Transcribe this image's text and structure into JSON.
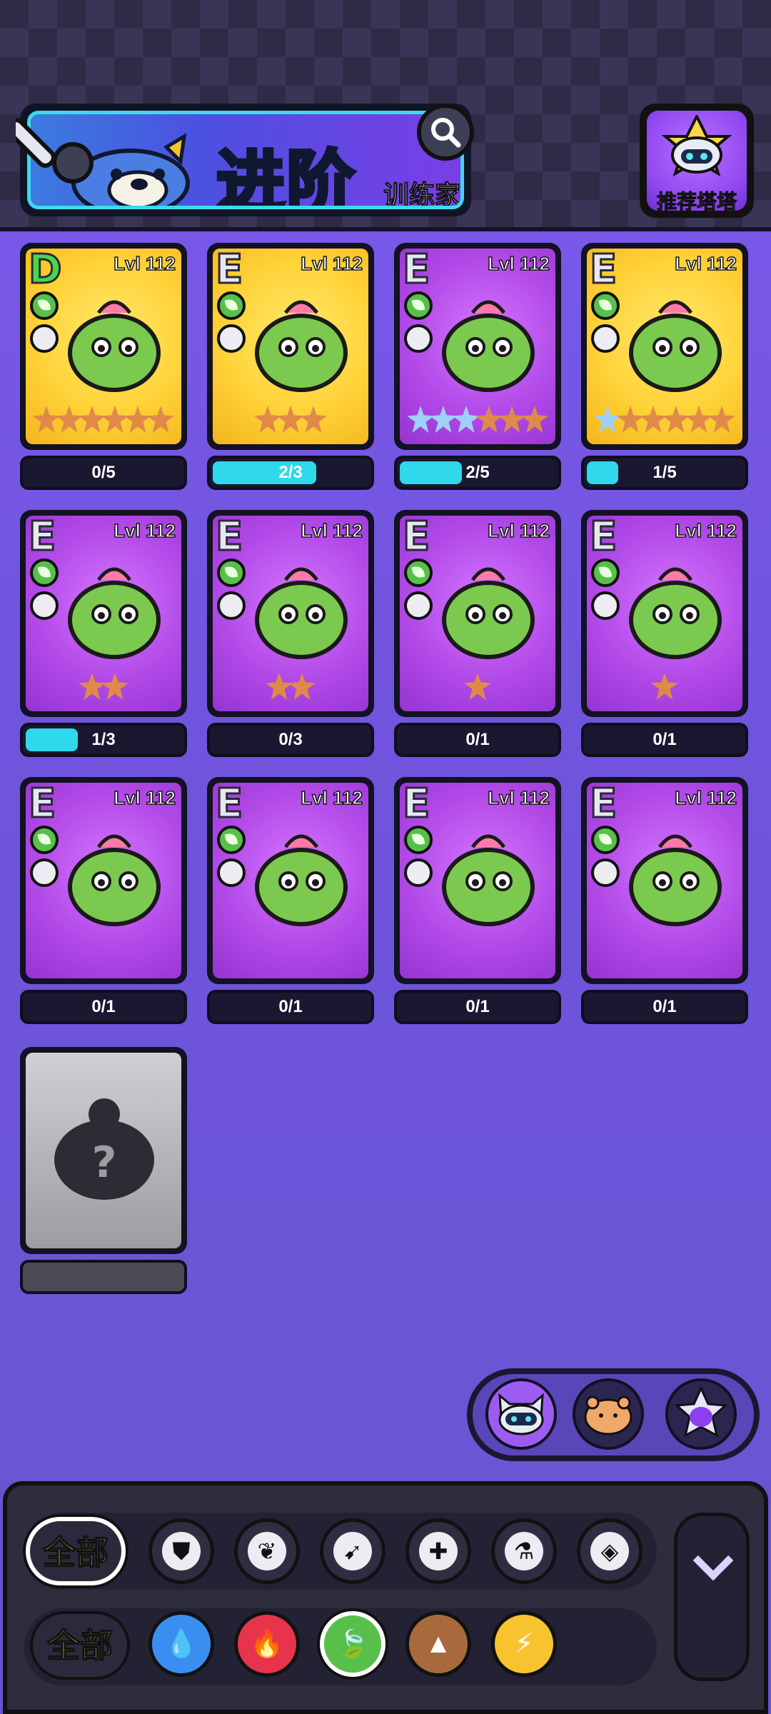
{
  "header": {
    "title": "进阶",
    "subtitle": "训练家",
    "search_icon": "magnifier-icon",
    "recommend_label": "推荐塔塔"
  },
  "colors": {
    "progress_fill": "#2fd8ea",
    "card_purple": "#b24ae8",
    "card_yellow": "#ffd238",
    "grass_element": "#58c04a",
    "filter_all_text": "#ffcf44"
  },
  "cards": [
    {
      "grade": "D",
      "level": "Lvl 112",
      "element": "grass",
      "class_icon": "bird-icon",
      "bg": "yellow",
      "stars_blue": 0,
      "stars_orange": 6,
      "progress_text": "0/5",
      "progress": 0.0
    },
    {
      "grade": "E",
      "level": "Lvl 112",
      "element": "grass",
      "class_icon": "dash-icon",
      "bg": "yellow",
      "stars_blue": 0,
      "stars_orange": 3,
      "progress_text": "2/3",
      "progress": 0.6667
    },
    {
      "grade": "E",
      "level": "Lvl 112",
      "element": "grass",
      "class_icon": "cross-icon",
      "bg": "purple",
      "stars_blue": 3,
      "stars_orange": 3,
      "progress_text": "2/5",
      "progress": 0.4
    },
    {
      "grade": "E",
      "level": "Lvl 112",
      "element": "grass",
      "class_icon": "bird-icon",
      "bg": "yellow",
      "stars_blue": 1,
      "stars_orange": 5,
      "progress_text": "1/5",
      "progress": 0.2
    },
    {
      "grade": "E",
      "level": "Lvl 112",
      "element": "grass",
      "class_icon": "diamond-icon",
      "bg": "purple",
      "stars_blue": 0,
      "stars_orange": 2,
      "progress_text": "1/3",
      "progress": 0.3333
    },
    {
      "grade": "E",
      "level": "Lvl 112",
      "element": "grass",
      "class_icon": "dash-icon",
      "bg": "purple",
      "stars_blue": 0,
      "stars_orange": 2,
      "progress_text": "0/3",
      "progress": 0.0
    },
    {
      "grade": "E",
      "level": "Lvl 112",
      "element": "grass",
      "class_icon": "flask-icon",
      "bg": "purple",
      "stars_blue": 0,
      "stars_orange": 1,
      "progress_text": "0/1",
      "progress": 0.0
    },
    {
      "grade": "E",
      "level": "Lvl 112",
      "element": "grass",
      "class_icon": "flask-icon",
      "bg": "purple",
      "stars_blue": 0,
      "stars_orange": 1,
      "progress_text": "0/1",
      "progress": 0.0
    },
    {
      "grade": "E",
      "level": "Lvl 112",
      "element": "grass",
      "class_icon": "dash-icon",
      "bg": "purple",
      "stars_blue": 0,
      "stars_orange": 0,
      "progress_text": "0/1",
      "progress": 0.0
    },
    {
      "grade": "E",
      "level": "Lvl 112",
      "element": "grass",
      "class_icon": "cross-icon",
      "bg": "purple",
      "stars_blue": 0,
      "stars_orange": 0,
      "progress_text": "0/1",
      "progress": 0.0
    },
    {
      "grade": "E",
      "level": "Lvl 112",
      "element": "grass",
      "class_icon": "shield-icon",
      "bg": "purple",
      "stars_blue": 0,
      "stars_orange": 0,
      "progress_text": "0/1",
      "progress": 0.0
    },
    {
      "grade": "E",
      "level": "Lvl 112",
      "element": "grass",
      "class_icon": "dash-icon",
      "bg": "purple",
      "stars_blue": 0,
      "stars_orange": 0,
      "progress_text": "0/1",
      "progress": 0.0
    }
  ],
  "locked_card": {
    "mark": "?"
  },
  "pet_switcher": {
    "items": [
      "cat-robot-icon",
      "hamster-icon",
      "star-cat-icon"
    ],
    "active": 0
  },
  "filters": {
    "class_row": {
      "all_label": "全部",
      "all_selected": true,
      "items": [
        {
          "icon": "shield-icon",
          "glyph": "⛊"
        },
        {
          "icon": "bird-icon",
          "glyph": "❦"
        },
        {
          "icon": "dash-icon",
          "glyph": "➹"
        },
        {
          "icon": "cross-icon",
          "glyph": "✚"
        },
        {
          "icon": "flask-icon",
          "glyph": "⚗"
        },
        {
          "icon": "diamond-icon",
          "glyph": "◈"
        }
      ]
    },
    "element_row": {
      "all_label": "全部",
      "all_selected": false,
      "items": [
        {
          "icon": "water-icon",
          "glyph": "💧"
        },
        {
          "icon": "fire-icon",
          "glyph": "🔥"
        },
        {
          "icon": "grass-icon",
          "glyph": "🍃",
          "selected": true
        },
        {
          "icon": "earth-icon",
          "glyph": "▲"
        },
        {
          "icon": "electric-icon",
          "glyph": "⚡"
        }
      ]
    },
    "expand_icon": "chevron-down-icon"
  }
}
